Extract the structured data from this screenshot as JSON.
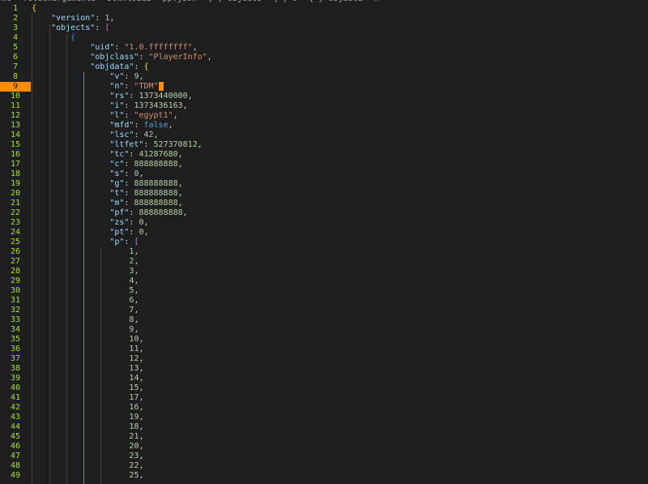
{
  "breadcrumb": [
    "me",
    "Téléchargements",
    "Downloads",
    "pp.json",
    "[ ] objects",
    "{ } 0",
    "{ } objdata",
    "n"
  ],
  "current_line": 9,
  "colors": {
    "background": "#1e1e1e",
    "line_number": "#a6e22e",
    "current_line_marker": "#ff8c00",
    "key": "#9cdcfe",
    "string": "#ce9178",
    "number": "#b5cea8",
    "boolean": "#569cd6",
    "bracket_level_1": "#ffd700",
    "bracket_level_2": "#da70d6",
    "bracket_level_3": "#179fff"
  },
  "lines": [
    {
      "n": "1",
      "tokens": [
        {
          "t": "{",
          "c": "br1"
        }
      ]
    },
    {
      "n": "2",
      "tokens": [
        {
          "t": "    "
        },
        {
          "t": "\"version\"",
          "c": "k"
        },
        {
          "t": ": "
        },
        {
          "t": "1",
          "c": "n"
        },
        {
          "t": ","
        }
      ]
    },
    {
      "n": "3",
      "tokens": [
        {
          "t": "    "
        },
        {
          "t": "\"objects\"",
          "c": "k"
        },
        {
          "t": ": "
        },
        {
          "t": "[",
          "c": "br2"
        }
      ]
    },
    {
      "n": "4",
      "tokens": [
        {
          "t": "        "
        },
        {
          "t": "{",
          "c": "br3"
        }
      ]
    },
    {
      "n": "5",
      "tokens": [
        {
          "t": "            "
        },
        {
          "t": "\"uid\"",
          "c": "k"
        },
        {
          "t": ": "
        },
        {
          "t": "\"1.0.ffffffff\"",
          "c": "s"
        },
        {
          "t": ","
        }
      ]
    },
    {
      "n": "6",
      "tokens": [
        {
          "t": "            "
        },
        {
          "t": "\"objclass\"",
          "c": "k"
        },
        {
          "t": ": "
        },
        {
          "t": "\"PlayerInfo\"",
          "c": "s"
        },
        {
          "t": ","
        }
      ]
    },
    {
      "n": "7",
      "tokens": [
        {
          "t": "            "
        },
        {
          "t": "\"objdata\"",
          "c": "k"
        },
        {
          "t": ": "
        },
        {
          "t": "{",
          "c": "br1"
        }
      ]
    },
    {
      "n": "8",
      "tokens": [
        {
          "t": "                "
        },
        {
          "t": "\"v\"",
          "c": "k"
        },
        {
          "t": ": "
        },
        {
          "t": "9",
          "c": "n"
        },
        {
          "t": ","
        }
      ]
    },
    {
      "n": "9",
      "tokens": [
        {
          "t": "                "
        },
        {
          "t": "\"n\"",
          "c": "k"
        },
        {
          "t": ": "
        },
        {
          "t": "\"TDM\"",
          "c": "s"
        },
        {
          "t": "",
          "c": "cursor"
        }
      ]
    },
    {
      "n": "10",
      "tokens": [
        {
          "t": "                "
        },
        {
          "t": "\"rs\"",
          "c": "k"
        },
        {
          "t": ": "
        },
        {
          "t": "1373440000",
          "c": "n"
        },
        {
          "t": ","
        }
      ]
    },
    {
      "n": "11",
      "tokens": [
        {
          "t": "                "
        },
        {
          "t": "\"i\"",
          "c": "k"
        },
        {
          "t": ": "
        },
        {
          "t": "1373436163",
          "c": "n"
        },
        {
          "t": ","
        }
      ]
    },
    {
      "n": "12",
      "tokens": [
        {
          "t": "                "
        },
        {
          "t": "\"l\"",
          "c": "k"
        },
        {
          "t": ": "
        },
        {
          "t": "\"egypt1\"",
          "c": "s"
        },
        {
          "t": ","
        }
      ]
    },
    {
      "n": "13",
      "tokens": [
        {
          "t": "                "
        },
        {
          "t": "\"mfd\"",
          "c": "k"
        },
        {
          "t": ": "
        },
        {
          "t": "false",
          "c": "b"
        },
        {
          "t": ","
        }
      ]
    },
    {
      "n": "14",
      "tokens": [
        {
          "t": "                "
        },
        {
          "t": "\"lsc\"",
          "c": "k"
        },
        {
          "t": ": "
        },
        {
          "t": "42",
          "c": "n"
        },
        {
          "t": ","
        }
      ]
    },
    {
      "n": "15",
      "tokens": [
        {
          "t": "                "
        },
        {
          "t": "\"ltfet\"",
          "c": "k"
        },
        {
          "t": ": "
        },
        {
          "t": "527370812",
          "c": "n"
        },
        {
          "t": ","
        }
      ]
    },
    {
      "n": "16",
      "tokens": [
        {
          "t": "                "
        },
        {
          "t": "\"tc\"",
          "c": "k"
        },
        {
          "t": ": "
        },
        {
          "t": "41287680",
          "c": "n"
        },
        {
          "t": ","
        }
      ]
    },
    {
      "n": "17",
      "tokens": [
        {
          "t": "                "
        },
        {
          "t": "\"c\"",
          "c": "k"
        },
        {
          "t": ": "
        },
        {
          "t": "888888888",
          "c": "n"
        },
        {
          "t": ","
        }
      ]
    },
    {
      "n": "18",
      "tokens": [
        {
          "t": "                "
        },
        {
          "t": "\"s\"",
          "c": "k"
        },
        {
          "t": ": "
        },
        {
          "t": "0",
          "c": "n"
        },
        {
          "t": ","
        }
      ]
    },
    {
      "n": "19",
      "tokens": [
        {
          "t": "                "
        },
        {
          "t": "\"g\"",
          "c": "k"
        },
        {
          "t": ": "
        },
        {
          "t": "888888888",
          "c": "n"
        },
        {
          "t": ","
        }
      ]
    },
    {
      "n": "20",
      "tokens": [
        {
          "t": "                "
        },
        {
          "t": "\"t\"",
          "c": "k"
        },
        {
          "t": ": "
        },
        {
          "t": "888888888",
          "c": "n"
        },
        {
          "t": ","
        }
      ]
    },
    {
      "n": "21",
      "tokens": [
        {
          "t": "                "
        },
        {
          "t": "\"m\"",
          "c": "k"
        },
        {
          "t": ": "
        },
        {
          "t": "888888888",
          "c": "n"
        },
        {
          "t": ","
        }
      ]
    },
    {
      "n": "22",
      "tokens": [
        {
          "t": "                "
        },
        {
          "t": "\"pf\"",
          "c": "k"
        },
        {
          "t": ": "
        },
        {
          "t": "888888888",
          "c": "n"
        },
        {
          "t": ","
        }
      ]
    },
    {
      "n": "23",
      "tokens": [
        {
          "t": "                "
        },
        {
          "t": "\"zs\"",
          "c": "k"
        },
        {
          "t": ": "
        },
        {
          "t": "0",
          "c": "n"
        },
        {
          "t": ","
        }
      ]
    },
    {
      "n": "24",
      "tokens": [
        {
          "t": "                "
        },
        {
          "t": "\"pt\"",
          "c": "k"
        },
        {
          "t": ": "
        },
        {
          "t": "0",
          "c": "n"
        },
        {
          "t": ","
        }
      ]
    },
    {
      "n": "25",
      "tokens": [
        {
          "t": "                "
        },
        {
          "t": "\"p\"",
          "c": "k"
        },
        {
          "t": ": "
        },
        {
          "t": "[",
          "c": "br2"
        }
      ]
    },
    {
      "n": "26",
      "tokens": [
        {
          "t": "                    "
        },
        {
          "t": "1",
          "c": "n"
        },
        {
          "t": ","
        }
      ]
    },
    {
      "n": "27",
      "tokens": [
        {
          "t": "                    "
        },
        {
          "t": "2",
          "c": "n"
        },
        {
          "t": ","
        }
      ]
    },
    {
      "n": "28",
      "tokens": [
        {
          "t": "                    "
        },
        {
          "t": "3",
          "c": "n"
        },
        {
          "t": ","
        }
      ]
    },
    {
      "n": "29",
      "tokens": [
        {
          "t": "                    "
        },
        {
          "t": "4",
          "c": "n"
        },
        {
          "t": ","
        }
      ]
    },
    {
      "n": "30",
      "tokens": [
        {
          "t": "                    "
        },
        {
          "t": "5",
          "c": "n"
        },
        {
          "t": ","
        }
      ]
    },
    {
      "n": "31",
      "tokens": [
        {
          "t": "                    "
        },
        {
          "t": "6",
          "c": "n"
        },
        {
          "t": ","
        }
      ]
    },
    {
      "n": "32",
      "tokens": [
        {
          "t": "                    "
        },
        {
          "t": "7",
          "c": "n"
        },
        {
          "t": ","
        }
      ]
    },
    {
      "n": "33",
      "tokens": [
        {
          "t": "                    "
        },
        {
          "t": "8",
          "c": "n"
        },
        {
          "t": ","
        }
      ]
    },
    {
      "n": "34",
      "tokens": [
        {
          "t": "                    "
        },
        {
          "t": "9",
          "c": "n"
        },
        {
          "t": ","
        }
      ]
    },
    {
      "n": "35",
      "tokens": [
        {
          "t": "                    "
        },
        {
          "t": "10",
          "c": "n"
        },
        {
          "t": ","
        }
      ]
    },
    {
      "n": "36",
      "tokens": [
        {
          "t": "                    "
        },
        {
          "t": "11",
          "c": "n"
        },
        {
          "t": ","
        }
      ]
    },
    {
      "n": "37",
      "tokens": [
        {
          "t": "                    "
        },
        {
          "t": "12",
          "c": "n"
        },
        {
          "t": ","
        }
      ]
    },
    {
      "n": "38",
      "tokens": [
        {
          "t": "                    "
        },
        {
          "t": "13",
          "c": "n"
        },
        {
          "t": ","
        }
      ]
    },
    {
      "n": "39",
      "tokens": [
        {
          "t": "                    "
        },
        {
          "t": "14",
          "c": "n"
        },
        {
          "t": ","
        }
      ]
    },
    {
      "n": "40",
      "tokens": [
        {
          "t": "                    "
        },
        {
          "t": "15",
          "c": "n"
        },
        {
          "t": ","
        }
      ]
    },
    {
      "n": "41",
      "tokens": [
        {
          "t": "                    "
        },
        {
          "t": "17",
          "c": "n"
        },
        {
          "t": ","
        }
      ]
    },
    {
      "n": "42",
      "tokens": [
        {
          "t": "                    "
        },
        {
          "t": "16",
          "c": "n"
        },
        {
          "t": ","
        }
      ]
    },
    {
      "n": "43",
      "tokens": [
        {
          "t": "                    "
        },
        {
          "t": "19",
          "c": "n"
        },
        {
          "t": ","
        }
      ]
    },
    {
      "n": "44",
      "tokens": [
        {
          "t": "                    "
        },
        {
          "t": "18",
          "c": "n"
        },
        {
          "t": ","
        }
      ]
    },
    {
      "n": "45",
      "tokens": [
        {
          "t": "                    "
        },
        {
          "t": "21",
          "c": "n"
        },
        {
          "t": ","
        }
      ]
    },
    {
      "n": "46",
      "tokens": [
        {
          "t": "                    "
        },
        {
          "t": "20",
          "c": "n"
        },
        {
          "t": ","
        }
      ]
    },
    {
      "n": "47",
      "tokens": [
        {
          "t": "                    "
        },
        {
          "t": "23",
          "c": "n"
        },
        {
          "t": ","
        }
      ]
    },
    {
      "n": "48",
      "tokens": [
        {
          "t": "                    "
        },
        {
          "t": "22",
          "c": "n"
        },
        {
          "t": ","
        }
      ]
    },
    {
      "n": "49",
      "tokens": [
        {
          "t": "                    "
        },
        {
          "t": "25",
          "c": "n"
        },
        {
          "t": ","
        }
      ]
    }
  ]
}
